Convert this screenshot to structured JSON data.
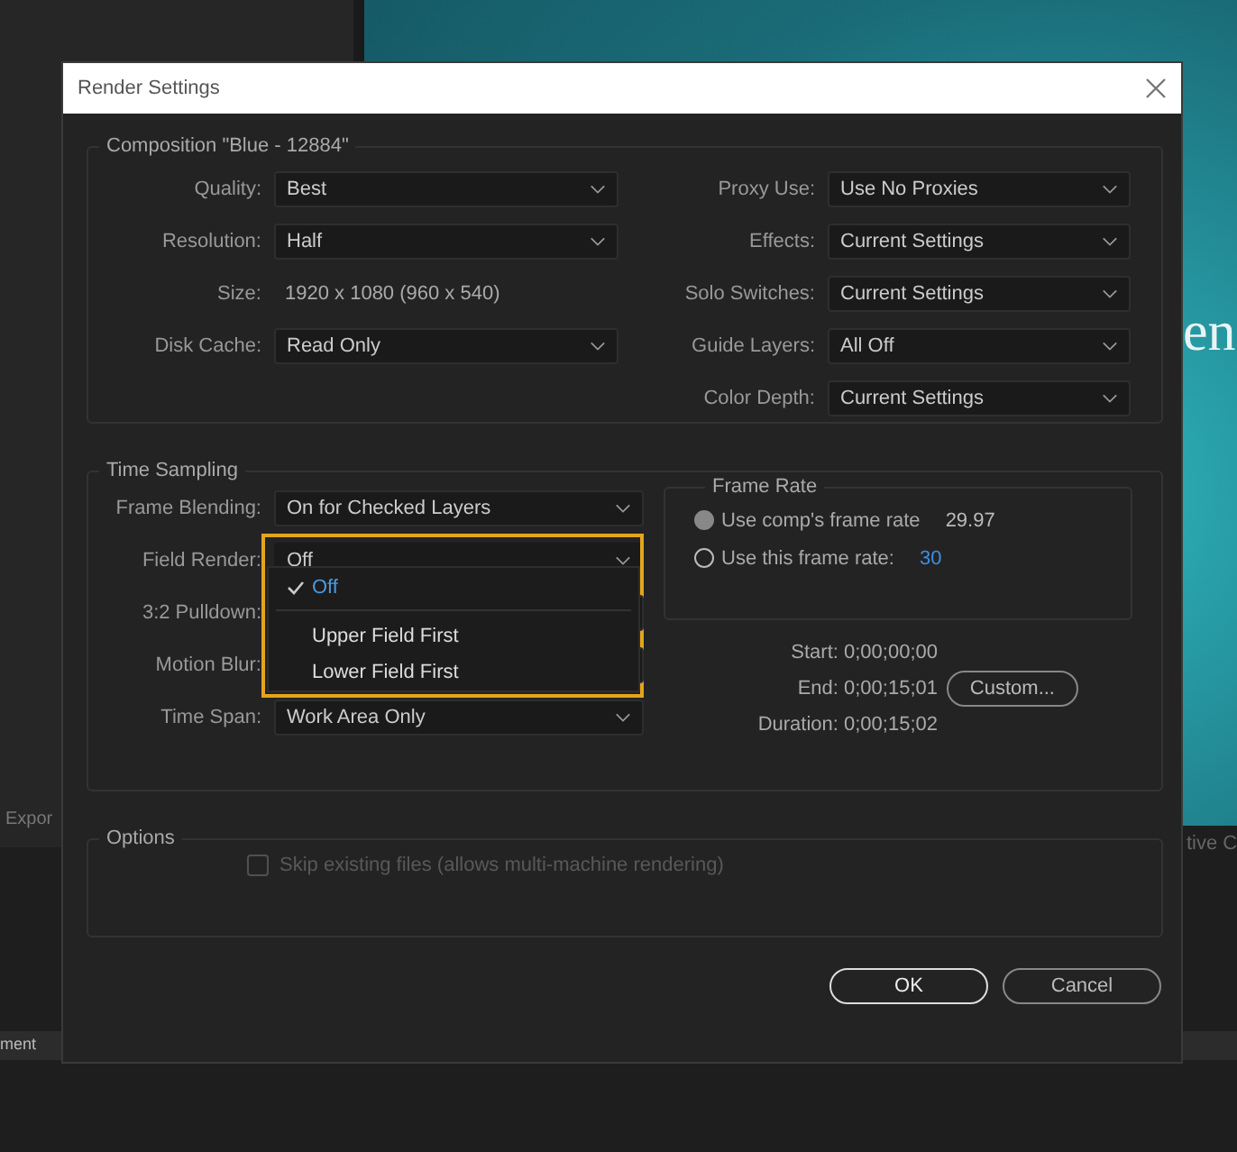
{
  "background": {
    "left_label": "Expor",
    "right_label": "tive C",
    "bottom_label": "ment",
    "preview_text": "en"
  },
  "dialog": {
    "title": "Render Settings",
    "composition": {
      "title": "Composition \"Blue - 12884\"",
      "left_fields": [
        {
          "label": "Quality:",
          "kind": "dropdown",
          "value": "Best"
        },
        {
          "label": "Resolution:",
          "kind": "dropdown",
          "value": "Half"
        },
        {
          "label": "Size:",
          "kind": "text",
          "value": "1920 x 1080 (960 x 540)"
        },
        {
          "label": "Disk Cache:",
          "kind": "dropdown",
          "value": "Read Only"
        }
      ],
      "right_fields": [
        {
          "label": "Proxy Use:",
          "kind": "dropdown",
          "value": "Use No Proxies"
        },
        {
          "label": "Effects:",
          "kind": "dropdown",
          "value": "Current Settings"
        },
        {
          "label": "Solo Switches:",
          "kind": "dropdown",
          "value": "Current Settings"
        },
        {
          "label": "Guide Layers:",
          "kind": "dropdown",
          "value": "All Off"
        },
        {
          "label": "Color Depth:",
          "kind": "dropdown",
          "value": "Current Settings"
        }
      ]
    },
    "time_sampling": {
      "title": "Time Sampling",
      "fields": [
        {
          "label": "Frame Blending:",
          "value": "On for Checked Layers",
          "expanded": false
        },
        {
          "label": "Field Render:",
          "value": "Off",
          "expanded": true
        },
        {
          "label": "3:2 Pulldown:",
          "expanded": false
        },
        {
          "label": "Motion Blur:",
          "expanded": false
        },
        {
          "label": "Time Span:",
          "value": "Work Area Only",
          "expanded": false
        }
      ],
      "menu": [
        {
          "label": "Off",
          "selected": true
        },
        {
          "label": "Upper Field First",
          "selected": false
        },
        {
          "label": "Lower Field First",
          "selected": false
        }
      ],
      "frame_rate": {
        "title": "Frame Rate",
        "options": [
          {
            "label": "Use comp's frame rate",
            "value": "29.97",
            "selected": true
          },
          {
            "label": "Use this frame rate:",
            "value": "30",
            "selected": false
          }
        ]
      },
      "times": [
        "Start: 0;00;00;00",
        "End: 0;00;15;01",
        "Duration: 0;00;15;02"
      ],
      "custom_button": "Custom..."
    },
    "options": {
      "title": "Options",
      "checkbox": {
        "label": "Skip existing files (allows multi-machine rendering)",
        "checked": false,
        "disabled": true
      }
    },
    "buttons": [
      {
        "label": "OK",
        "kind": "primary"
      },
      {
        "label": "Cancel",
        "kind": "secondary"
      }
    ]
  }
}
